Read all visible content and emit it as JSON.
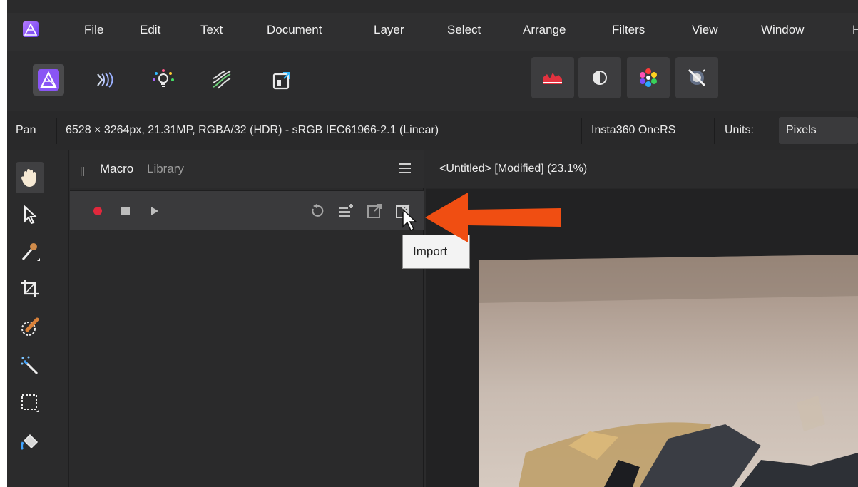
{
  "menubar": {
    "items": [
      "File",
      "Edit",
      "Text",
      "Document",
      "Layer",
      "Select",
      "Arrange",
      "Filters",
      "View",
      "Window",
      "H"
    ]
  },
  "personas": [
    "photo-persona",
    "liquify-persona",
    "develop-persona",
    "tone-mapping-persona",
    "export-persona"
  ],
  "studio_toggles": [
    "histogram",
    "adjustments",
    "color-wheel",
    "navigator"
  ],
  "context": {
    "tool": "Pan",
    "doc_info": "6528 × 3264px, 21.31MP, RGBA/32 (HDR) - sRGB IEC61966-2.1 (Linear)",
    "camera": "Insta360 OneRS",
    "units_label": "Units:",
    "units_value": "Pixels"
  },
  "panel": {
    "tabs": [
      "Macro",
      "Library"
    ]
  },
  "document": {
    "title": "<Untitled> [Modified] (23.1%)"
  },
  "tooltip": {
    "text": "Import"
  },
  "colors": {
    "record": "#e0283c",
    "arrow": "#f04e12",
    "brand_purple": "#8a55f5"
  }
}
